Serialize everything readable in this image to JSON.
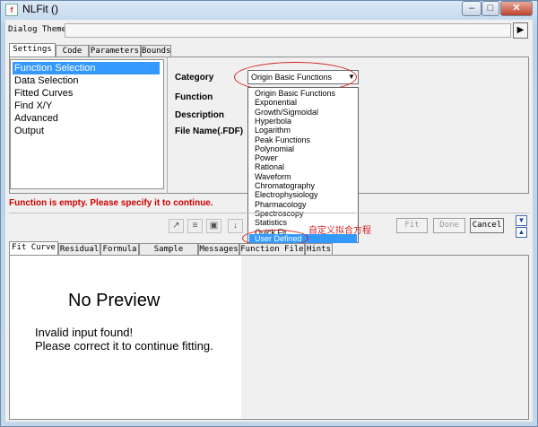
{
  "window": {
    "title": "NLFit ()",
    "buttons": {
      "minimize": "–",
      "maximize": "□",
      "close": "✕"
    }
  },
  "dialog_theme": {
    "label": "Dialog Theme",
    "value": "",
    "arrow": "▶"
  },
  "top_tabs": [
    "Settings",
    "Code",
    "Parameters",
    "Bounds"
  ],
  "tree": [
    "Function Selection",
    "Data Selection",
    "Fitted Curves",
    "Find X/Y",
    "Advanced",
    "Output"
  ],
  "fields": {
    "category": "Category",
    "function": "Function",
    "description": "Description",
    "file_name": "File Name(.FDF)"
  },
  "category_combo": {
    "value": "Origin Basic Functions",
    "arrow": "▼"
  },
  "dropdown_items": [
    "Origin Basic Functions",
    "Exponential",
    "Growth/Sigmoidal",
    "Hyperbola",
    "Logarithm",
    "Peak Functions",
    "Polynomial",
    "Power",
    "Rational",
    "Waveform",
    "Chromatography",
    "Electrophysiology",
    "Pharmacology",
    "Spectroscopy",
    "Statistics",
    "Quick Fit",
    "User Defined"
  ],
  "annotation": "自定义拟合方程",
  "status_message": "Function is empty. Please specify it to continue.",
  "toolbar": {
    "btn1": "↗",
    "btn2": "≡",
    "btn3": "▣",
    "btn4": "↓"
  },
  "actions": {
    "fit": "Fit",
    "done": "Done",
    "cancel": "Cancel"
  },
  "nav": {
    "down": "▼",
    "up": "▲"
  },
  "bottom_tabs": [
    "Fit Curve",
    "Residual",
    "Formula",
    "Sample Curve",
    "Messages",
    "Function File",
    "Hints"
  ],
  "preview": {
    "title": "No Preview",
    "line1": "Invalid input found!",
    "line2": "Please correct it to continue fitting."
  },
  "colors": {
    "selection": "#3399ff",
    "error": "#cc0000",
    "annotation": "#d12020"
  }
}
